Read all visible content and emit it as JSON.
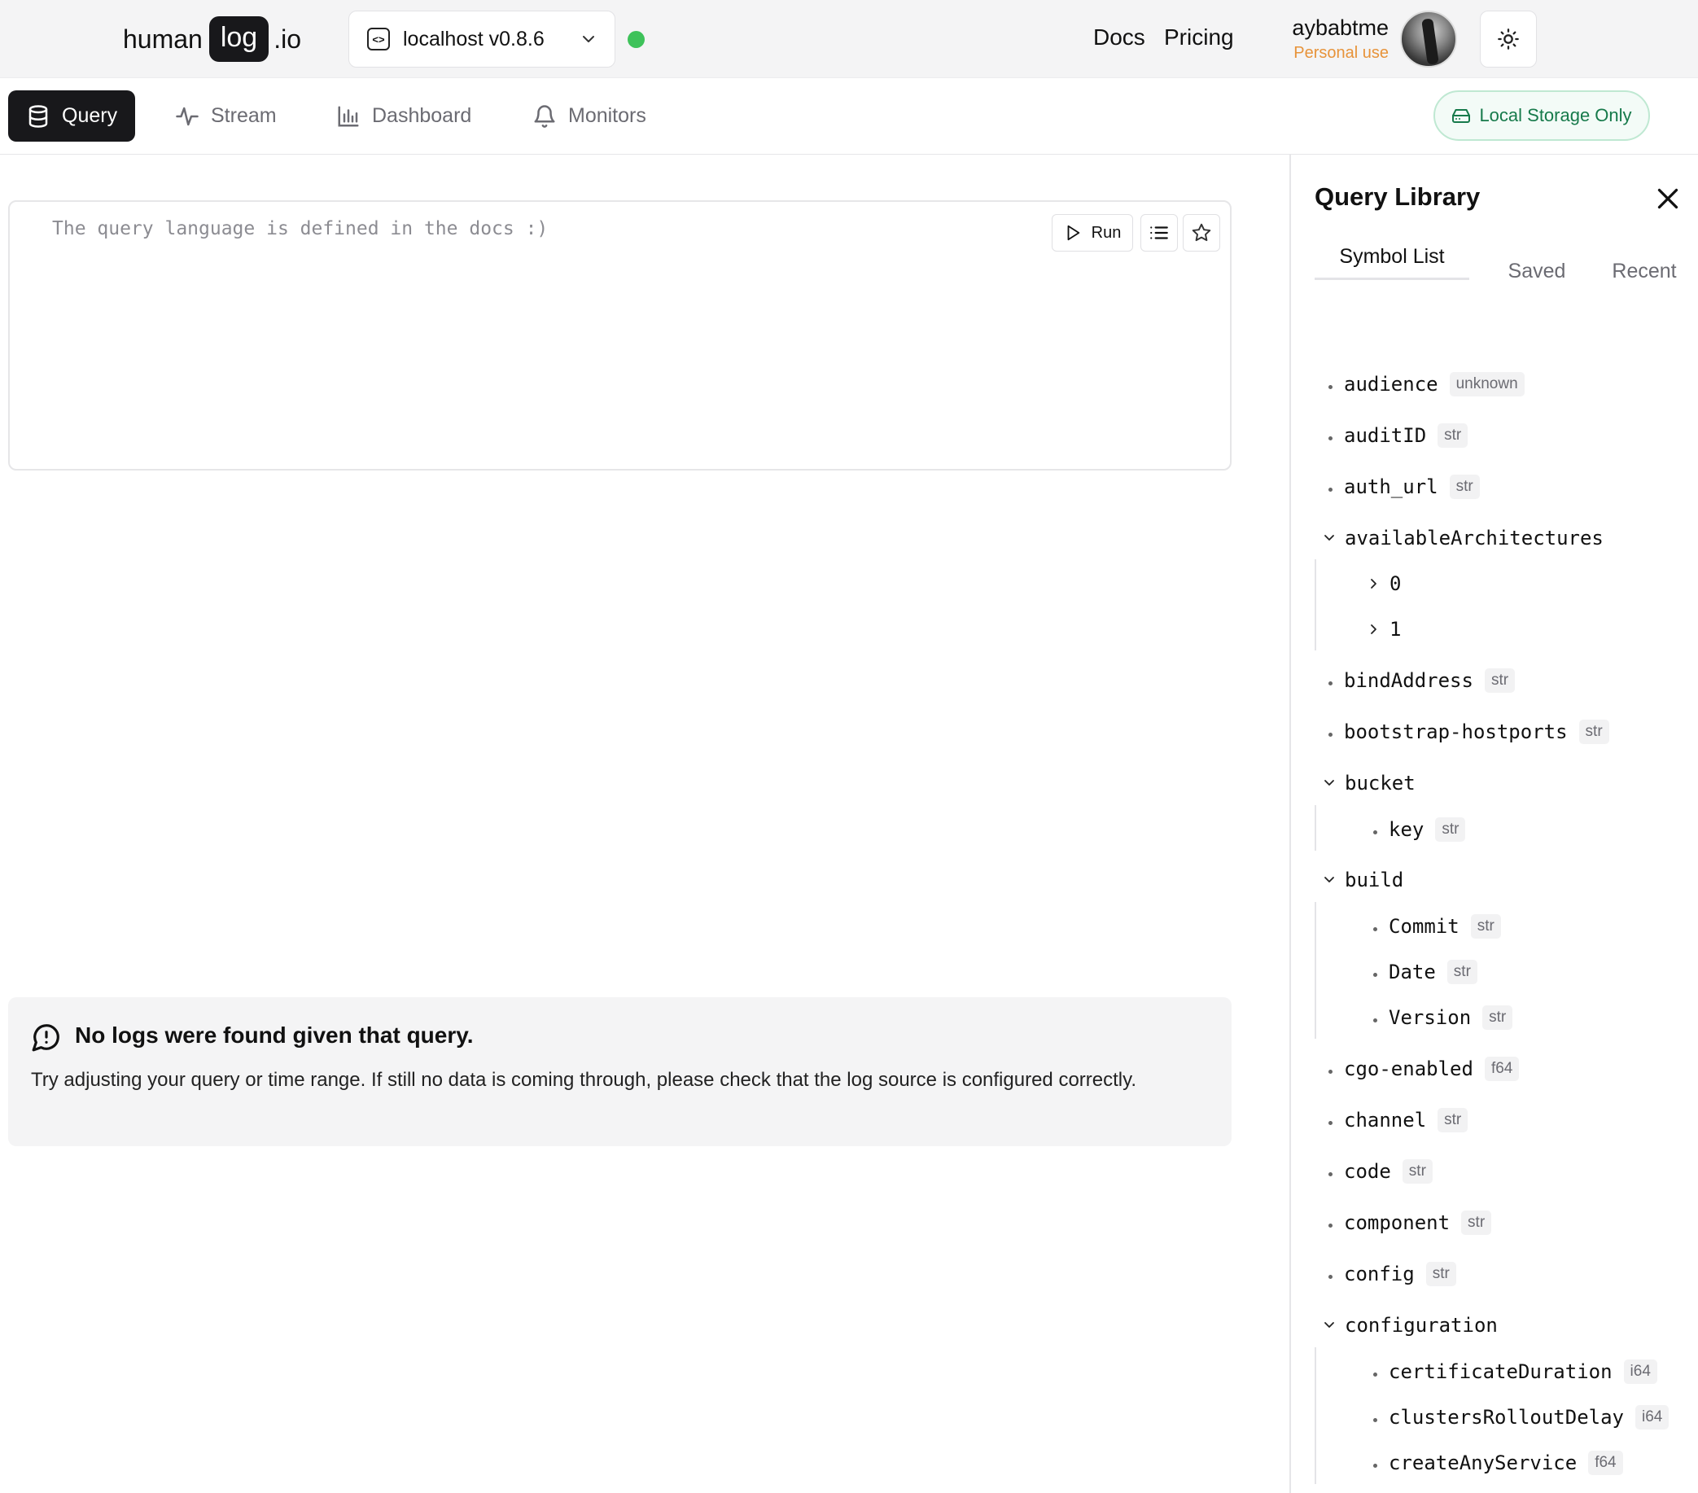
{
  "header": {
    "brand": {
      "left": "human",
      "pill": "log",
      "right": ".io"
    },
    "environment": {
      "label": "localhost v0.8.6",
      "status_color": "#3ec25a"
    },
    "links": [
      {
        "label": "Docs"
      },
      {
        "label": "Pricing"
      }
    ],
    "user": {
      "name": "aybabtme",
      "plan": "Personal use"
    }
  },
  "tabs": [
    {
      "label": "Query",
      "icon": "database-icon",
      "active": true
    },
    {
      "label": "Stream",
      "icon": "activity-icon",
      "active": false
    },
    {
      "label": "Dashboard",
      "icon": "bar-chart-icon",
      "active": false
    },
    {
      "label": "Monitors",
      "icon": "bell-icon",
      "active": false
    }
  ],
  "storage_badge": "Local Storage Only",
  "editor": {
    "placeholder": "The query language is defined in the docs :)",
    "run_label": "Run"
  },
  "empty_state": {
    "title": "No logs were found given that query.",
    "description": "Try adjusting your query or time range. If still no data is coming through, please check that the log source is configured correctly."
  },
  "library": {
    "title": "Query Library",
    "tabs": [
      {
        "label": "Symbol List",
        "active": true
      },
      {
        "label": "Saved",
        "active": false
      },
      {
        "label": "Recent",
        "active": false
      }
    ],
    "symbols": [
      {
        "name": "audience",
        "type": "unknown",
        "depth": 0,
        "kind": "leaf"
      },
      {
        "name": "auditID",
        "type": "str",
        "depth": 0,
        "kind": "leaf"
      },
      {
        "name": "auth_url",
        "type": "str",
        "depth": 0,
        "kind": "leaf"
      },
      {
        "name": "availableArchitectures",
        "type": "",
        "depth": 0,
        "kind": "expanded"
      },
      {
        "name": "0",
        "type": "",
        "depth": 1,
        "kind": "collapsed"
      },
      {
        "name": "1",
        "type": "",
        "depth": 1,
        "kind": "collapsed"
      },
      {
        "name": "bindAddress",
        "type": "str",
        "depth": 0,
        "kind": "leaf"
      },
      {
        "name": "bootstrap-hostports",
        "type": "str",
        "depth": 0,
        "kind": "leaf"
      },
      {
        "name": "bucket",
        "type": "",
        "depth": 0,
        "kind": "expanded"
      },
      {
        "name": "key",
        "type": "str",
        "depth": 1,
        "kind": "leaf"
      },
      {
        "name": "build",
        "type": "",
        "depth": 0,
        "kind": "expanded"
      },
      {
        "name": "Commit",
        "type": "str",
        "depth": 1,
        "kind": "leaf"
      },
      {
        "name": "Date",
        "type": "str",
        "depth": 1,
        "kind": "leaf"
      },
      {
        "name": "Version",
        "type": "str",
        "depth": 1,
        "kind": "leaf"
      },
      {
        "name": "cgo-enabled",
        "type": "f64",
        "depth": 0,
        "kind": "leaf"
      },
      {
        "name": "channel",
        "type": "str",
        "depth": 0,
        "kind": "leaf"
      },
      {
        "name": "code",
        "type": "str",
        "depth": 0,
        "kind": "leaf"
      },
      {
        "name": "component",
        "type": "str",
        "depth": 0,
        "kind": "leaf"
      },
      {
        "name": "config",
        "type": "str",
        "depth": 0,
        "kind": "leaf"
      },
      {
        "name": "configuration",
        "type": "",
        "depth": 0,
        "kind": "expanded"
      },
      {
        "name": "certificateDuration",
        "type": "i64",
        "depth": 1,
        "kind": "leaf"
      },
      {
        "name": "clustersRolloutDelay",
        "type": "i64",
        "depth": 1,
        "kind": "leaf"
      },
      {
        "name": "createAnyService",
        "type": "f64",
        "depth": 1,
        "kind": "leaf"
      }
    ]
  }
}
